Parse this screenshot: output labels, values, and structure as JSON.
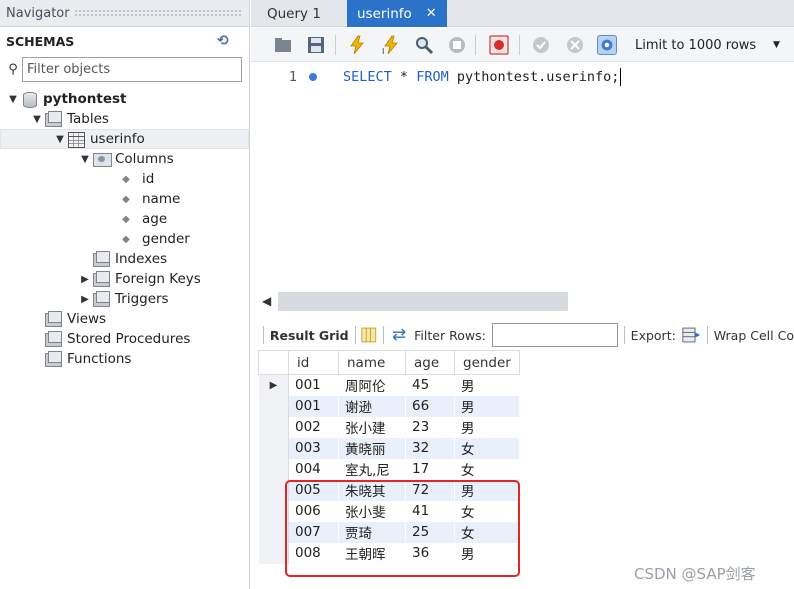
{
  "navigator": {
    "title": "Navigator",
    "schemas_label": "SCHEMAS",
    "filter_placeholder": "Filter objects",
    "tree": {
      "schema": "pythontest",
      "tables": "Tables",
      "table": "userinfo",
      "columns_folder": "Columns",
      "columns": [
        "id",
        "name",
        "age",
        "gender"
      ],
      "indexes": "Indexes",
      "foreign_keys": "Foreign Keys",
      "triggers": "Triggers",
      "views": "Views",
      "stored_procedures": "Stored Procedures",
      "functions": "Functions"
    }
  },
  "tabs": [
    {
      "label": "Query 1",
      "active": false
    },
    {
      "label": "userinfo",
      "active": true
    }
  ],
  "toolbar": {
    "limit_label": "Limit to 1000 rows"
  },
  "editor": {
    "line_number": "1",
    "keyword_select": "SELECT",
    "star": "*",
    "keyword_from": "FROM",
    "target": "pythontest.userinfo;"
  },
  "result": {
    "result_grid_label": "Result Grid",
    "filter_rows_label": "Filter Rows:",
    "export_label": "Export:",
    "wrap_label": "Wrap Cell Co",
    "columns": [
      "id",
      "name",
      "age",
      "gender"
    ],
    "rows": [
      [
        "001",
        "周阿伦",
        "45",
        "男"
      ],
      [
        "001",
        "谢逊",
        "66",
        "男"
      ],
      [
        "002",
        "张小建",
        "23",
        "男"
      ],
      [
        "003",
        "黄晓丽",
        "32",
        "女"
      ],
      [
        "004",
        "室丸,尼",
        "17",
        "女"
      ],
      [
        "005",
        "朱晓其",
        "72",
        "男"
      ],
      [
        "006",
        "张小斐",
        "41",
        "女"
      ],
      [
        "007",
        "贾琦",
        "25",
        "女"
      ],
      [
        "008",
        "王朝晖",
        "36",
        "男"
      ]
    ]
  },
  "watermark": "CSDN @SAP剑客",
  "colors": {
    "active_tab": "#2a73c9",
    "keyword": "#2060c8",
    "highlight_box": "#e02626",
    "row_alt": "#eaf0fb"
  }
}
